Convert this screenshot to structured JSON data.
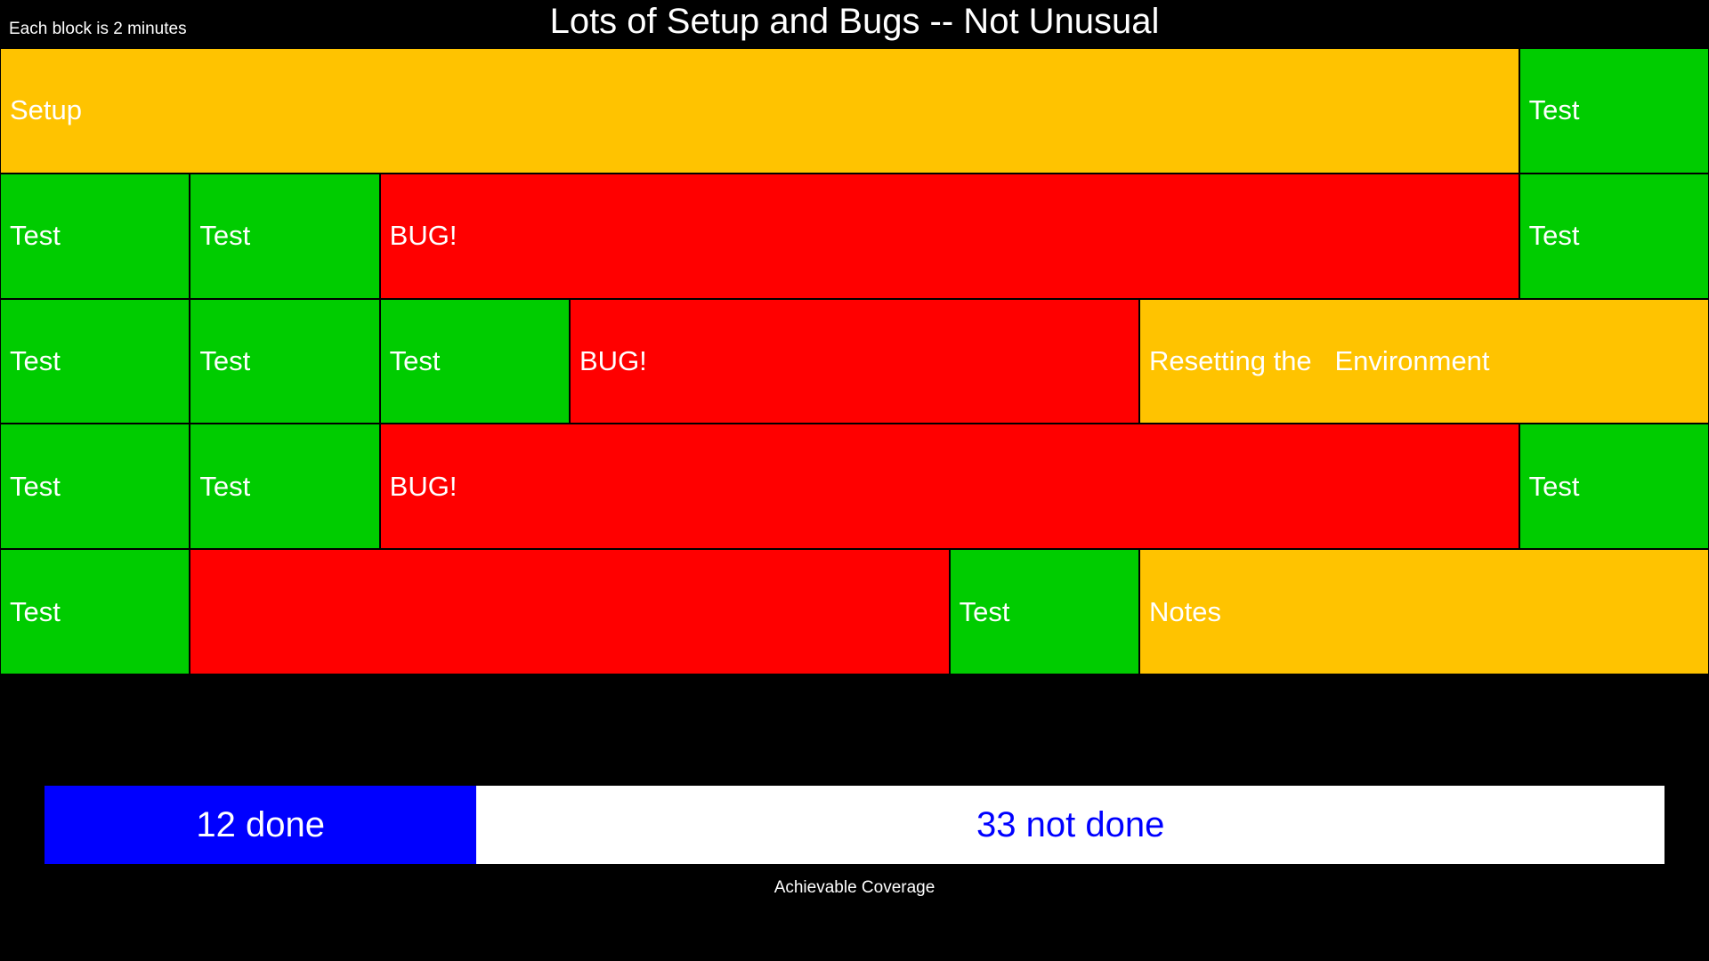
{
  "header": {
    "note": "Each block is 2 minutes",
    "title": "Lots of Setup and Bugs -- Not Unusual"
  },
  "colors": {
    "setup": "#FFC300",
    "test": "#00CC00",
    "bug": "#FF0000",
    "done": "#0000FF",
    "not_done": "#FFFFFF",
    "not_done_text": "#0000FF"
  },
  "grid": {
    "columns": 9,
    "rows": [
      [
        {
          "label": "Setup",
          "type": "setup",
          "span": 8
        },
        {
          "label": "Test",
          "type": "test",
          "span": 1
        }
      ],
      [
        {
          "label": "Test",
          "type": "test",
          "span": 1
        },
        {
          "label": "Test",
          "type": "test",
          "span": 1
        },
        {
          "label": "BUG!",
          "type": "bug",
          "span": 6
        },
        {
          "label": "Test",
          "type": "test",
          "span": 1
        }
      ],
      [
        {
          "label": "Test",
          "type": "test",
          "span": 1
        },
        {
          "label": "Test",
          "type": "test",
          "span": 1
        },
        {
          "label": "Test",
          "type": "test",
          "span": 1
        },
        {
          "label": "BUG!",
          "type": "bug",
          "span": 3
        },
        {
          "label": "Resetting the   Environment",
          "type": "setup",
          "span": 3
        }
      ],
      [
        {
          "label": "Test",
          "type": "test",
          "span": 1
        },
        {
          "label": "Test",
          "type": "test",
          "span": 1
        },
        {
          "label": "BUG!",
          "type": "bug",
          "span": 6
        },
        {
          "label": "Test",
          "type": "test",
          "span": 1
        }
      ],
      [
        {
          "label": "Test",
          "type": "test",
          "span": 1
        },
        {
          "label": "",
          "type": "bug",
          "span": 4
        },
        {
          "label": "Test",
          "type": "test",
          "span": 1
        },
        {
          "label": "Notes",
          "type": "setup",
          "span": 3
        }
      ]
    ]
  },
  "coverage": {
    "done": 12,
    "not_done": 33,
    "done_label": "12 done",
    "not_done_label": "33 not done",
    "caption": "Achievable Coverage"
  }
}
